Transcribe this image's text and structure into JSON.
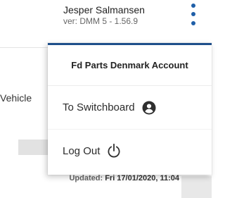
{
  "header": {
    "user_name": "Jesper Salmansen",
    "version": "ver: DMM 5 - 1.56.9",
    "menu_icon": "kebab-menu-icon",
    "accent_color": "#1f5fa8"
  },
  "background": {
    "vehicle_label": "Vehicle",
    "updated_label": "Updated:",
    "updated_value": "Fri 17/01/2020, 11:04"
  },
  "menu": {
    "account_title": "Fd Parts Denmark Account",
    "items": [
      {
        "label": "To Switchboard",
        "icon": "user-circle-icon"
      },
      {
        "label": "Log Out",
        "icon": "power-icon"
      }
    ]
  }
}
